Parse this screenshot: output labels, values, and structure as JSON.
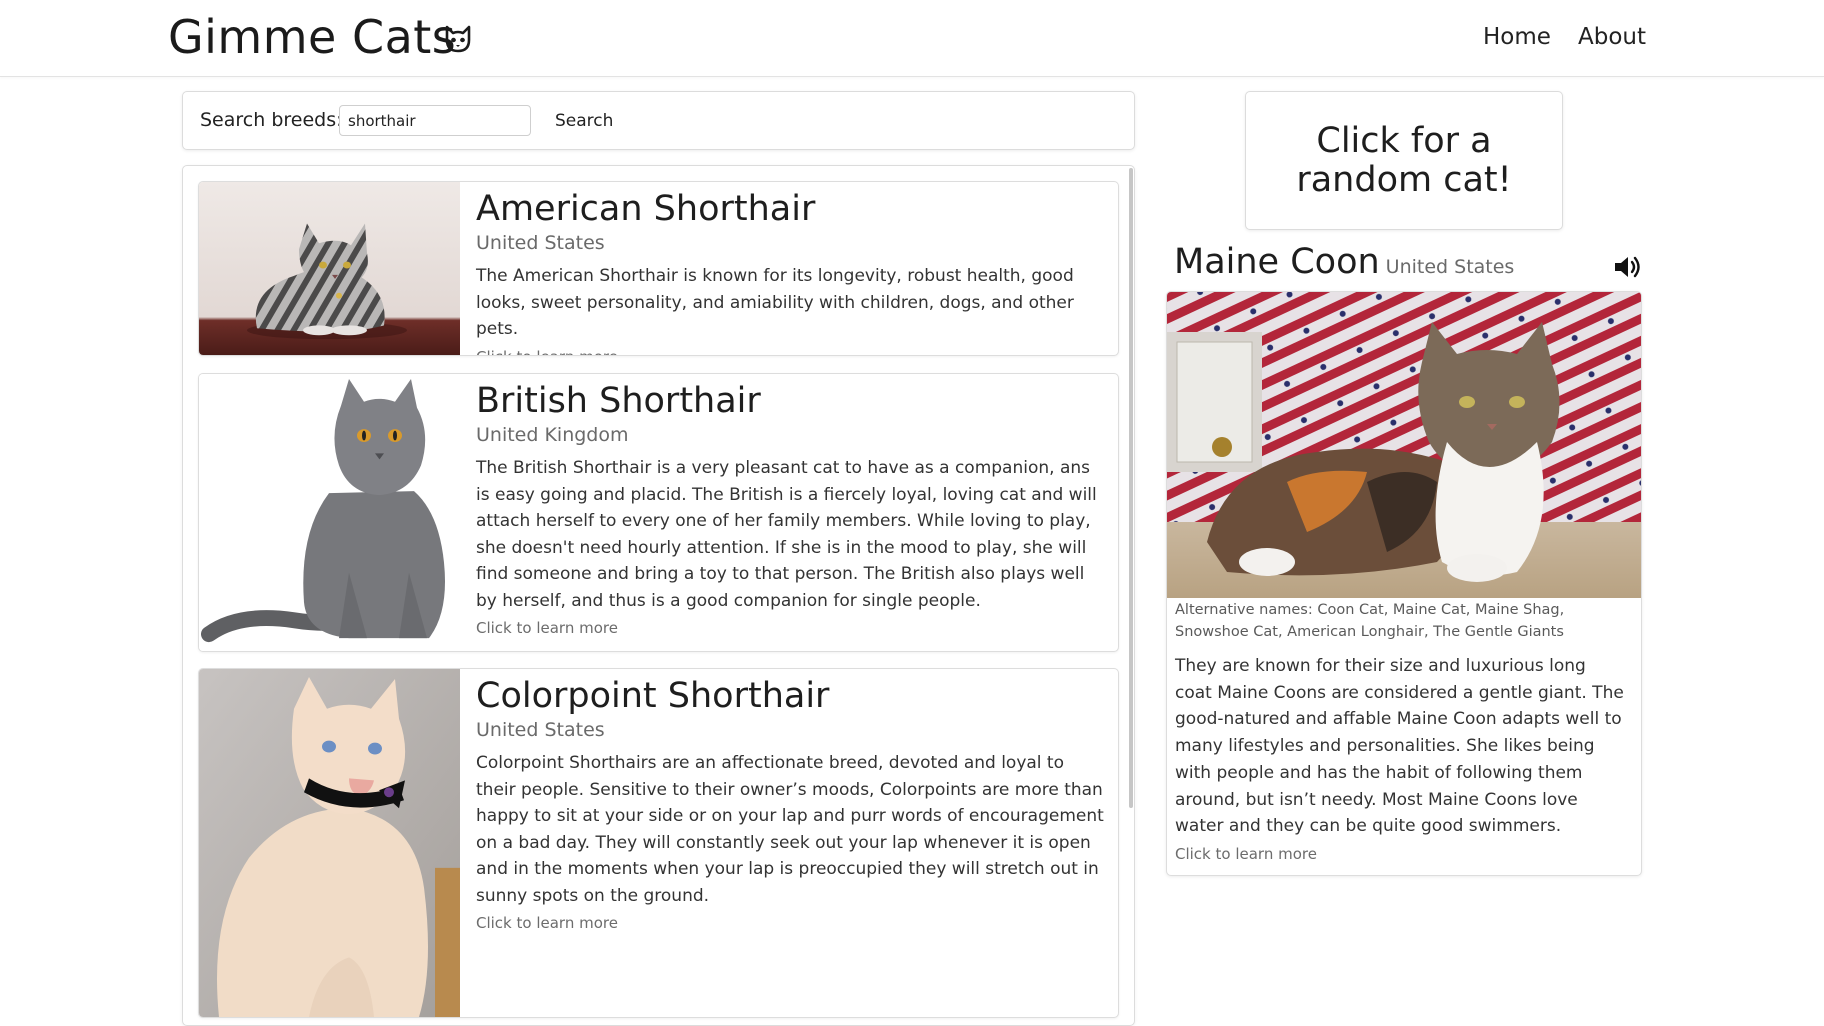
{
  "header": {
    "logo_text": "Gimme Cats",
    "logo_icon": "cat-face-icon",
    "nav": [
      {
        "label": "Home"
      },
      {
        "label": "About"
      }
    ]
  },
  "search": {
    "label": "Search breeds:",
    "value": "shorthair",
    "button_label": "Search"
  },
  "results": [
    {
      "name": "American Shorthair",
      "origin": "United States",
      "description": "The American Shorthair is known for its longevity, robust health, good looks, sweet personality, and amiability with children, dogs, and other pets.",
      "more_label": "Click to learn more"
    },
    {
      "name": "British Shorthair",
      "origin": "United Kingdom",
      "description": "The British Shorthair is a very pleasant cat to have as a companion, ans is easy going and placid. The British is a fiercely loyal, loving cat and will attach herself to every one of her family members. While loving to play, she doesn't need hourly attention. If she is in the mood to play, she will find someone and bring a toy to that person. The British also plays well by herself, and thus is a good companion for single people.",
      "more_label": "Click to learn more"
    },
    {
      "name": "Colorpoint Shorthair",
      "origin": "United States",
      "description": "Colorpoint Shorthairs are an affectionate breed, devoted and loyal to their people. Sensitive to their owner’s moods, Colorpoints are more than happy to sit at your side or on your lap and purr words of encouragement on a bad day. They will constantly seek out your lap whenever it is open and in the moments when your lap is preoccupied they will stretch out in sunny spots on the ground.",
      "more_label": "Click to learn more"
    }
  ],
  "random_button": {
    "label": "Click for a random cat!"
  },
  "featured": {
    "name": "Maine Coon",
    "origin": "United States",
    "sound_icon": "speaker-icon",
    "alt_names": "Alternative names: Coon Cat, Maine Cat, Maine Shag, Snowshoe Cat, American Longhair, The Gentle Giants",
    "description": "They are known for their size and luxurious long coat Maine Coons are considered a gentle giant. The good-natured and affable Maine Coon adapts well to many lifestyles and personalities. She likes being with people and has the habit of following them around, but isn’t needy. Most Maine Coons love water and they can be quite good swimmers.",
    "more_label": "Click to learn more"
  }
}
